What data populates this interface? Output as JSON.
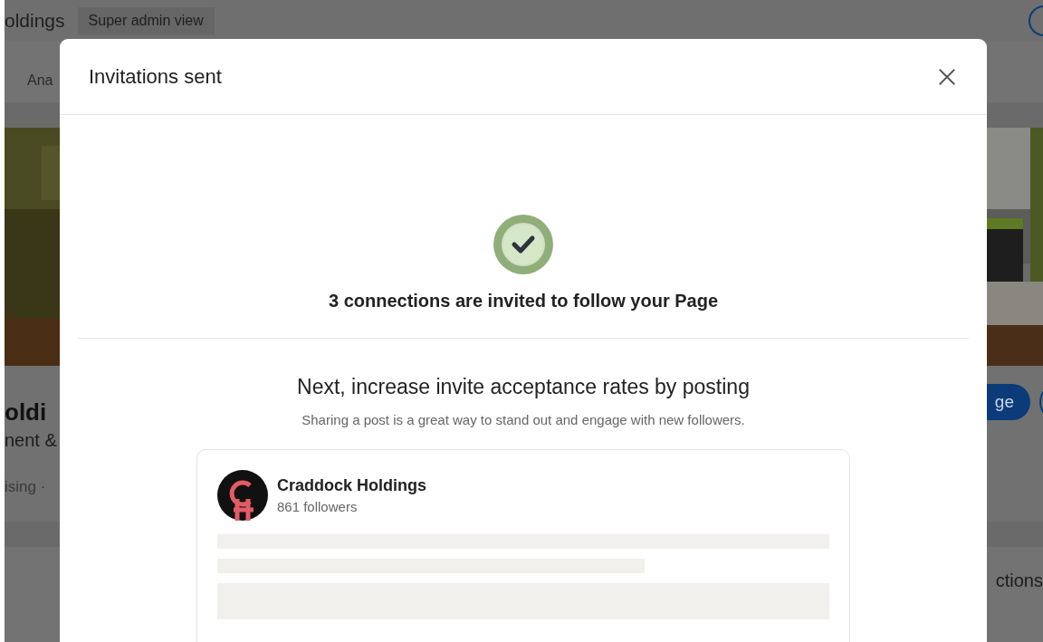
{
  "background": {
    "company_name": "oldings",
    "badge": "Super admin view",
    "tab": "Ana",
    "company_heading": "oldi",
    "tagline": "nent &",
    "meta": "ising ·",
    "primary_button": "ge",
    "section_title": "ctions"
  },
  "dialog": {
    "title": "Invitations sent",
    "confirmation": "3 connections are invited to follow your Page",
    "prompt_title": "Next, increase invite acceptance rates by posting",
    "prompt_subtitle": "Sharing a post is a great way to stand out and engage with new followers.",
    "post_preview": {
      "author": "Craddock Holdings",
      "followers": "861 followers"
    }
  }
}
